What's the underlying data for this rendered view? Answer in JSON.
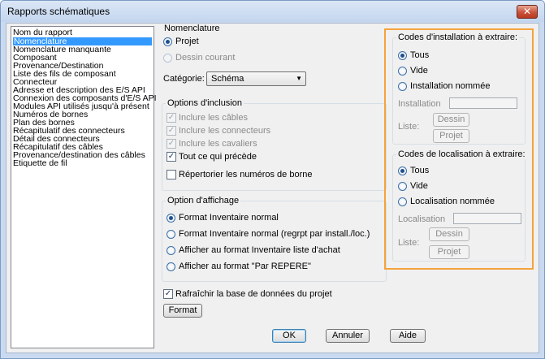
{
  "window": {
    "title": "Rapports schématiques",
    "close_glyph": "✕"
  },
  "report_list": {
    "header": "Nom du rapport",
    "items": [
      "Nomenclature",
      "Nomenclature manquante",
      "Composant",
      "Provenance/Destination",
      "Liste des fils de composant",
      "Connecteur",
      "Adresse et description des E/S API",
      "Connexion des composants d'E/S API",
      "Modules API utilisés jusqu'à présent",
      "Numéros de bornes",
      "Plan des bornes",
      "Récapitulatif des connecteurs",
      "Détail des connecteurs",
      "Récapitulatif des câbles",
      "Provenance/destination des câbles",
      "Etiquette de fil"
    ],
    "selected_index": 0
  },
  "nomenclature": {
    "title": "Nomenclature",
    "projet": "Projet",
    "dessin_courant": "Dessin courant",
    "categorie_label": "Catégorie:",
    "categorie_value": "Schéma",
    "arrow": "▼"
  },
  "inclusion": {
    "title": "Options d'inclusion",
    "cables": "Inclure les câbles",
    "connecteurs": "Inclure les connecteurs",
    "cavaliers": "Inclure les cavaliers",
    "precede": "Tout ce qui précède",
    "repertorier": "Répertorier les numéros de borne",
    "check_glyph": "✓"
  },
  "affichage": {
    "title": "Option d'affichage",
    "options": [
      "Format Inventaire normal",
      "Format Inventaire normal (regrpt par install./loc.)",
      "Afficher au format Inventaire liste d'achat",
      "Afficher au format \"Par REPERE\""
    ]
  },
  "installation": {
    "title": "Codes d'installation à extraire:",
    "tous": "Tous",
    "vide": "Vide",
    "nommee": "Installation nommée",
    "field_label": "Installation",
    "liste_label": "Liste:",
    "dessin_btn": "Dessin",
    "projet_btn": "Projet"
  },
  "localisation": {
    "title": "Codes de localisation à extraire:",
    "tous": "Tous",
    "vide": "Vide",
    "nommee": "Localisation nommée",
    "field_label": "Localisation",
    "liste_label": "Liste:",
    "dessin_btn": "Dessin",
    "projet_btn": "Projet"
  },
  "bottom": {
    "refresh": "Rafraîchir la base de données du projet",
    "format_btn": "Format",
    "ok": "OK",
    "annuler": "Annuler",
    "aide": "Aide"
  },
  "colors": {
    "highlight": "#f5a33a",
    "selection": "#3399ff"
  }
}
